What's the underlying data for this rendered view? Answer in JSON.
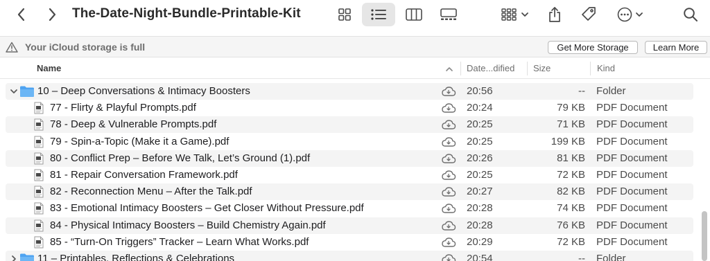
{
  "window": {
    "title": "The-Date-Night-Bundle-Printable-Kit"
  },
  "icloud": {
    "message": "Your iCloud storage is full",
    "get_more_label": "Get More Storage",
    "learn_more_label": "Learn More"
  },
  "columns": {
    "name": "Name",
    "date": "Date...dified",
    "size": "Size",
    "kind": "Kind"
  },
  "rows": [
    {
      "type": "folder",
      "expanded": true,
      "name": "10 – Deep Conversations & Intimacy Boosters",
      "date": "20:56",
      "size": "--",
      "kind": "Folder"
    },
    {
      "type": "file",
      "name": "77 - Flirty & Playful Prompts.pdf",
      "date": "20:24",
      "size": "79 KB",
      "kind": "PDF Document"
    },
    {
      "type": "file",
      "name": "78 - Deep & Vulnerable Prompts.pdf",
      "date": "20:25",
      "size": "71 KB",
      "kind": "PDF Document"
    },
    {
      "type": "file",
      "name": "79 - Spin-a-Topic (Make it a Game).pdf",
      "date": "20:25",
      "size": "199 KB",
      "kind": "PDF Document"
    },
    {
      "type": "file",
      "name": "80 - Conflict Prep – Before We Talk, Let’s Ground (1).pdf",
      "date": "20:26",
      "size": "81 KB",
      "kind": "PDF Document"
    },
    {
      "type": "file",
      "name": "81 - Repair Conversation Framework.pdf",
      "date": "20:25",
      "size": "72 KB",
      "kind": "PDF Document"
    },
    {
      "type": "file",
      "name": "82 - Reconnection Menu – After the Talk.pdf",
      "date": "20:27",
      "size": "82 KB",
      "kind": "PDF Document"
    },
    {
      "type": "file",
      "name": "83 - Emotional Intimacy Boosters – Get Closer Without Pressure.pdf",
      "date": "20:28",
      "size": "74 KB",
      "kind": "PDF Document"
    },
    {
      "type": "file",
      "name": "84 - Physical Intimacy Boosters – Build Chemistry Again.pdf",
      "date": "20:28",
      "size": "76 KB",
      "kind": "PDF Document"
    },
    {
      "type": "file",
      "name": "85 - “Turn-On Triggers” Tracker – Learn What Works.pdf",
      "date": "20:29",
      "size": "72 KB",
      "kind": "PDF Document"
    },
    {
      "type": "folder",
      "expanded": false,
      "name": "11 – Printables, Reflections & Celebrations",
      "date": "20:54",
      "size": "--",
      "kind": "Folder"
    }
  ],
  "colors": {
    "folder_blue": "#4ea3f1",
    "row_alt": "#f4f4f4",
    "muted_text": "#6e6e6e"
  }
}
